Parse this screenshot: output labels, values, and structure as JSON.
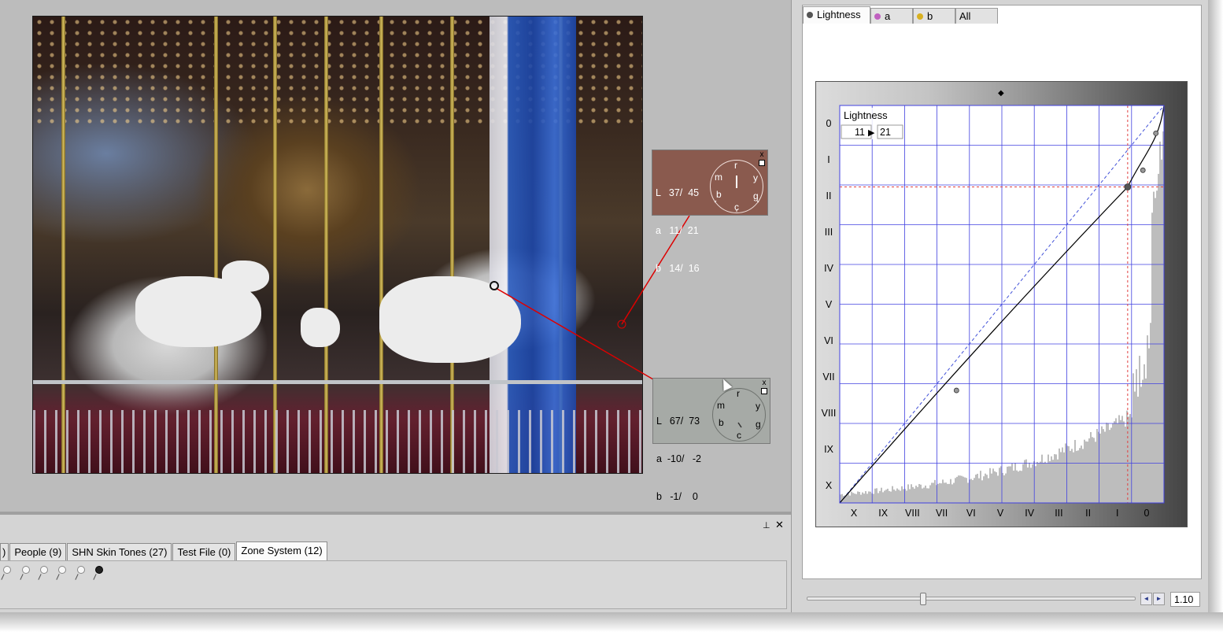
{
  "bottom_panel": {
    "tabs": [
      {
        "label": ")"
      },
      {
        "label": "People (9)"
      },
      {
        "label": "SHN Skin Tones (27)"
      },
      {
        "label": "Test File (0)"
      },
      {
        "label": "Zone System (12)",
        "active": true
      }
    ],
    "pin_icon": "pushpin-icon",
    "close_icon": "close-icon",
    "close_glyph": "✕",
    "pin_glyph": "⊥"
  },
  "readout_1": {
    "rows": [
      "L   37/  45",
      "a   11/  21",
      "b   14/  16"
    ],
    "dial_labels": {
      "r": "r",
      "y": "y",
      "g": "g",
      "c": "c",
      "b": "b",
      "m": "m"
    },
    "background": "#8a5a4e",
    "close_glyph": "x"
  },
  "readout_2": {
    "rows": [
      "L   67/  73",
      "a  -10/   -2",
      "b   -1/    0"
    ],
    "dial_labels": {
      "r": "r",
      "y": "y",
      "g": "g",
      "c": "c",
      "b": "b",
      "m": "m"
    },
    "background": "#a6aaa6",
    "close_glyph": "x"
  },
  "channel_tabs": [
    {
      "label": "Lightness",
      "active": true,
      "dot_color": "#555555"
    },
    {
      "label": "a",
      "active": false,
      "dot_color": "#c060c0"
    },
    {
      "label": "b",
      "active": false,
      "dot_color": "#d8b020"
    },
    {
      "label": "All",
      "active": false,
      "dot_color": ""
    }
  ],
  "curve": {
    "channel_label": "Lightness",
    "input_value": "11",
    "output_value": "21",
    "arrow_glyph": "▶",
    "top_marker_glyph": "◆",
    "zones_left": [
      "0",
      "I",
      "II",
      "III",
      "IV",
      "V",
      "VI",
      "VII",
      "VIII",
      "IX",
      "X"
    ],
    "zones_bottom": [
      "X",
      "IX",
      "VIII",
      "VII",
      "VI",
      "V",
      "IV",
      "III",
      "II",
      "I",
      "0"
    ],
    "grid_color": "#4040e0",
    "curve_color": "#000000",
    "reference_line_color": "#4050d8",
    "crosshair_color": "#e04040"
  },
  "zoom": {
    "value": "1.10",
    "left_arrow": "◄",
    "right_arrow": "►"
  }
}
